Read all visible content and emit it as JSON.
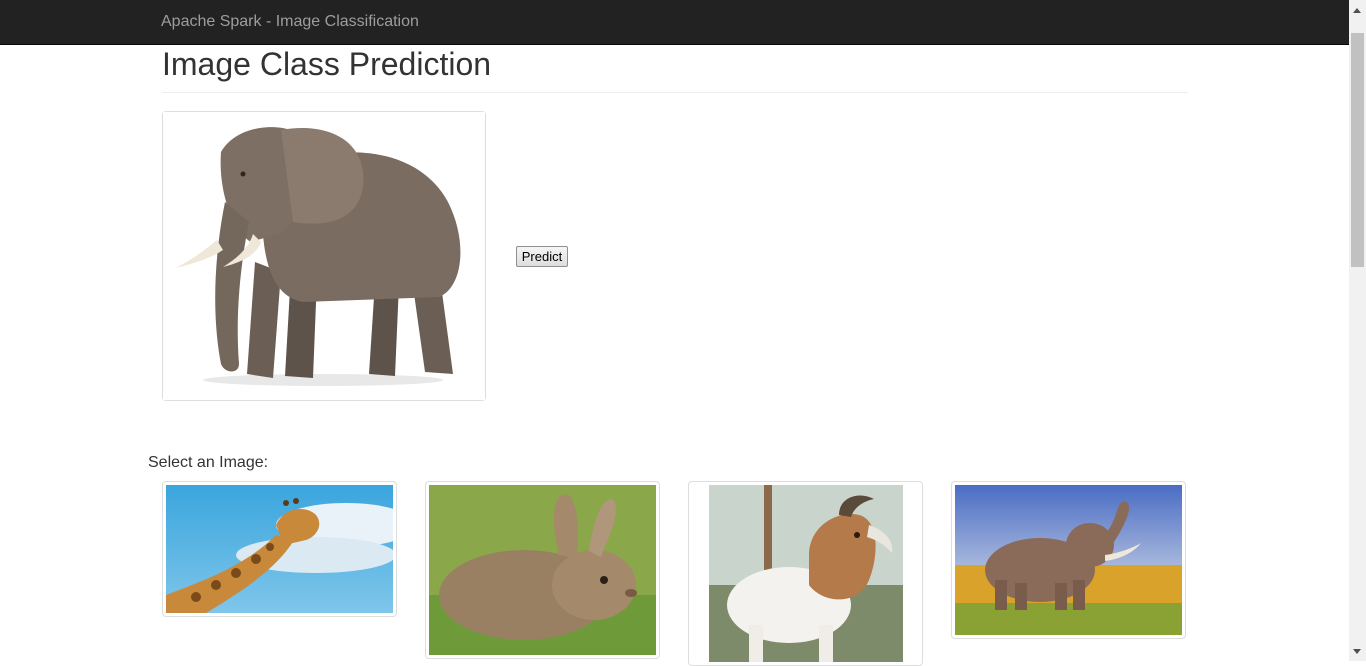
{
  "navbar": {
    "brand": "Apache Spark - Image Classification"
  },
  "main": {
    "title": "Image Class Prediction",
    "preview": {
      "subject": "elephant"
    },
    "predict_label": "Predict",
    "select_label": "Select an Image:",
    "gallery": [
      {
        "subject": "giraffe"
      },
      {
        "subject": "rabbit"
      },
      {
        "subject": "goat"
      },
      {
        "subject": "elephant"
      }
    ]
  },
  "colors": {
    "navbar_bg": "#222222",
    "navbar_text": "#9d9d9d",
    "border": "#dddddd"
  }
}
